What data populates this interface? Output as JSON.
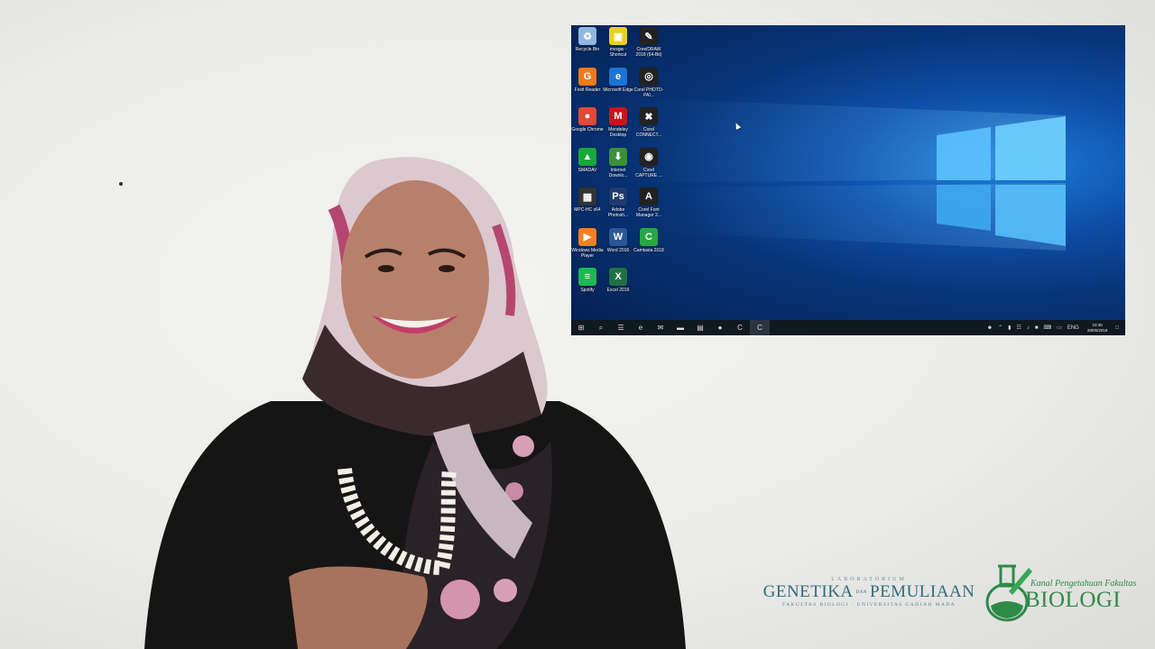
{
  "desktop": {
    "icons": [
      {
        "label": "Recycle Bin",
        "glyph": "♻",
        "color": "#8fb8e0",
        "icon": "recycle-bin-icon"
      },
      {
        "label": "mvsgw - Shortcut",
        "glyph": "▣",
        "color": "#e8d020",
        "icon": "mvsgw-icon"
      },
      {
        "label": "CorelDRAW 2018 (64-Bit)",
        "glyph": "✎",
        "color": "#222222",
        "icon": "coreldraw-icon"
      },
      {
        "label": "Foxit Reader",
        "glyph": "G",
        "color": "#f07a1a",
        "icon": "foxit-reader-icon"
      },
      {
        "label": "Microsoft Edge",
        "glyph": "e",
        "color": "#1c74d4",
        "icon": "edge-icon"
      },
      {
        "label": "Corel PHOTO-PAI...",
        "glyph": "◎",
        "color": "#222222",
        "icon": "corel-photopaint-icon"
      },
      {
        "label": "Google Chrome",
        "glyph": "●",
        "color": "#dd4b39",
        "icon": "chrome-icon"
      },
      {
        "label": "Mendeley Desktop",
        "glyph": "M",
        "color": "#c4161c",
        "icon": "mendeley-icon"
      },
      {
        "label": "Corel CONNECT...",
        "glyph": "✖",
        "color": "#222222",
        "icon": "corel-connect-icon"
      },
      {
        "label": "SMADAV",
        "glyph": "▲",
        "color": "#19a83c",
        "icon": "smadav-icon"
      },
      {
        "label": "Internet Downlo...",
        "glyph": "⬇",
        "color": "#3a8f3a",
        "icon": "internet-download-manager-icon"
      },
      {
        "label": "Corel CAPTURE ...",
        "glyph": "◉",
        "color": "#222222",
        "icon": "corel-capture-icon"
      },
      {
        "label": "MPC-HC x64",
        "glyph": "▦",
        "color": "#333333",
        "icon": "mpc-hc-icon"
      },
      {
        "label": "Adobe Photosh...",
        "glyph": "Ps",
        "color": "#1f3a6e",
        "icon": "photoshop-icon"
      },
      {
        "label": "Corel Font Manager 2...",
        "glyph": "A",
        "color": "#222222",
        "icon": "corel-font-manager-icon"
      },
      {
        "label": "Windows Media Player",
        "glyph": "▶",
        "color": "#f08020",
        "icon": "windows-media-player-icon"
      },
      {
        "label": "Word 2016",
        "glyph": "W",
        "color": "#2b5797",
        "icon": "word-icon"
      },
      {
        "label": "Camtasia 2018",
        "glyph": "C",
        "color": "#27a844",
        "icon": "camtasia-icon"
      },
      {
        "label": "Spotify",
        "glyph": "≡",
        "color": "#1db954",
        "icon": "spotify-icon"
      },
      {
        "label": "Excel 2016",
        "glyph": "X",
        "color": "#1e7145",
        "icon": "excel-icon"
      }
    ]
  },
  "taskbar": {
    "items": [
      {
        "glyph": "⊞",
        "icon": "start-icon"
      },
      {
        "glyph": "⌕",
        "icon": "search-icon"
      },
      {
        "glyph": "☰",
        "icon": "task-view-icon"
      },
      {
        "glyph": "e",
        "icon": "edge-icon"
      },
      {
        "glyph": "✉",
        "icon": "mail-icon"
      },
      {
        "glyph": "▬",
        "icon": "file-explorer-icon"
      },
      {
        "glyph": "▤",
        "icon": "store-icon"
      },
      {
        "glyph": "●",
        "icon": "chrome-icon"
      },
      {
        "glyph": "C",
        "icon": "camtasia-icon"
      },
      {
        "glyph": "C",
        "icon": "camtasia-recorder-icon"
      }
    ],
    "language": "ENG",
    "time": "23:36",
    "date": "28/05/2019"
  },
  "branding": {
    "lab_top": "LABORATORIUM",
    "lab_left": "GENETIKA",
    "lab_dan": "DAN",
    "lab_right": "PEMULIAAN",
    "lab_sub": "FAKULTAS BIOLOGI · UNIVERSITAS GADJAH MADA",
    "kanal": "Kanal Pengetahuan Fakultas",
    "biologi": "BIOLOGI"
  }
}
